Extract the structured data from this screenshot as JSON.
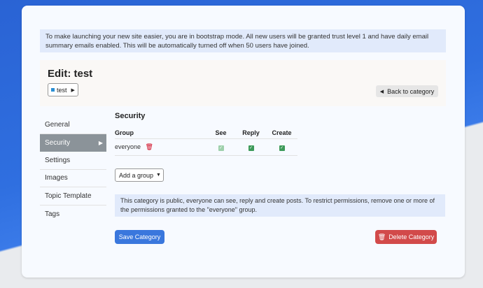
{
  "notice": {
    "text": "To make launching your new site easier, you are in bootstrap mode. All new users will be granted trust level 1 and have daily email summary emails enabled. This will be automatically turned off when 50 users have joined."
  },
  "header": {
    "title": "Edit: test",
    "category_chip": "test",
    "back_label": "Back to category"
  },
  "sidebar": {
    "items": [
      {
        "label": "General"
      },
      {
        "label": "Security"
      },
      {
        "label": "Settings"
      },
      {
        "label": "Images"
      },
      {
        "label": "Topic Template"
      },
      {
        "label": "Tags"
      }
    ],
    "active": "Security"
  },
  "security": {
    "title": "Security",
    "columns": [
      "Group",
      "See",
      "Reply",
      "Create"
    ],
    "rows": [
      {
        "group": "everyone",
        "see": true,
        "reply": true,
        "create": true
      }
    ],
    "add_group_label": "Add a group",
    "info_text": "This category is public, everyone can see, reply and create posts. To restrict permissions, remove one or more of the permissions granted to the \"everyone\" group."
  },
  "footer": {
    "save_label": "Save Category",
    "delete_label": "Delete Category"
  },
  "colors": {
    "primary": "#3a77dd",
    "danger": "#d24a4a",
    "success": "#3d9a5a",
    "notice_bg": "#e1eafb"
  }
}
